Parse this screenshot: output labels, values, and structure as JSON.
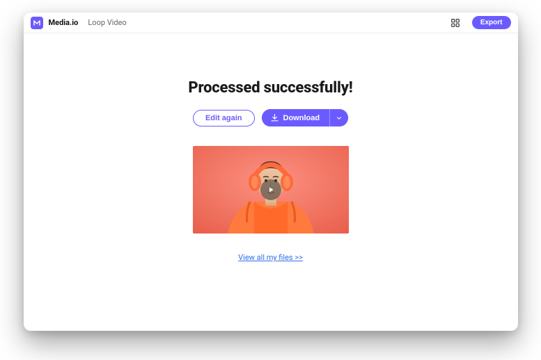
{
  "header": {
    "brand": "Media.io",
    "tool": "Loop Video",
    "export_label": "Export"
  },
  "main": {
    "headline": "Processed successfully!",
    "edit_label": "Edit again",
    "download_label": "Download",
    "view_all_label": "View all my files >>"
  },
  "colors": {
    "accent": "#6b5bff",
    "link": "#2e6fe8"
  }
}
